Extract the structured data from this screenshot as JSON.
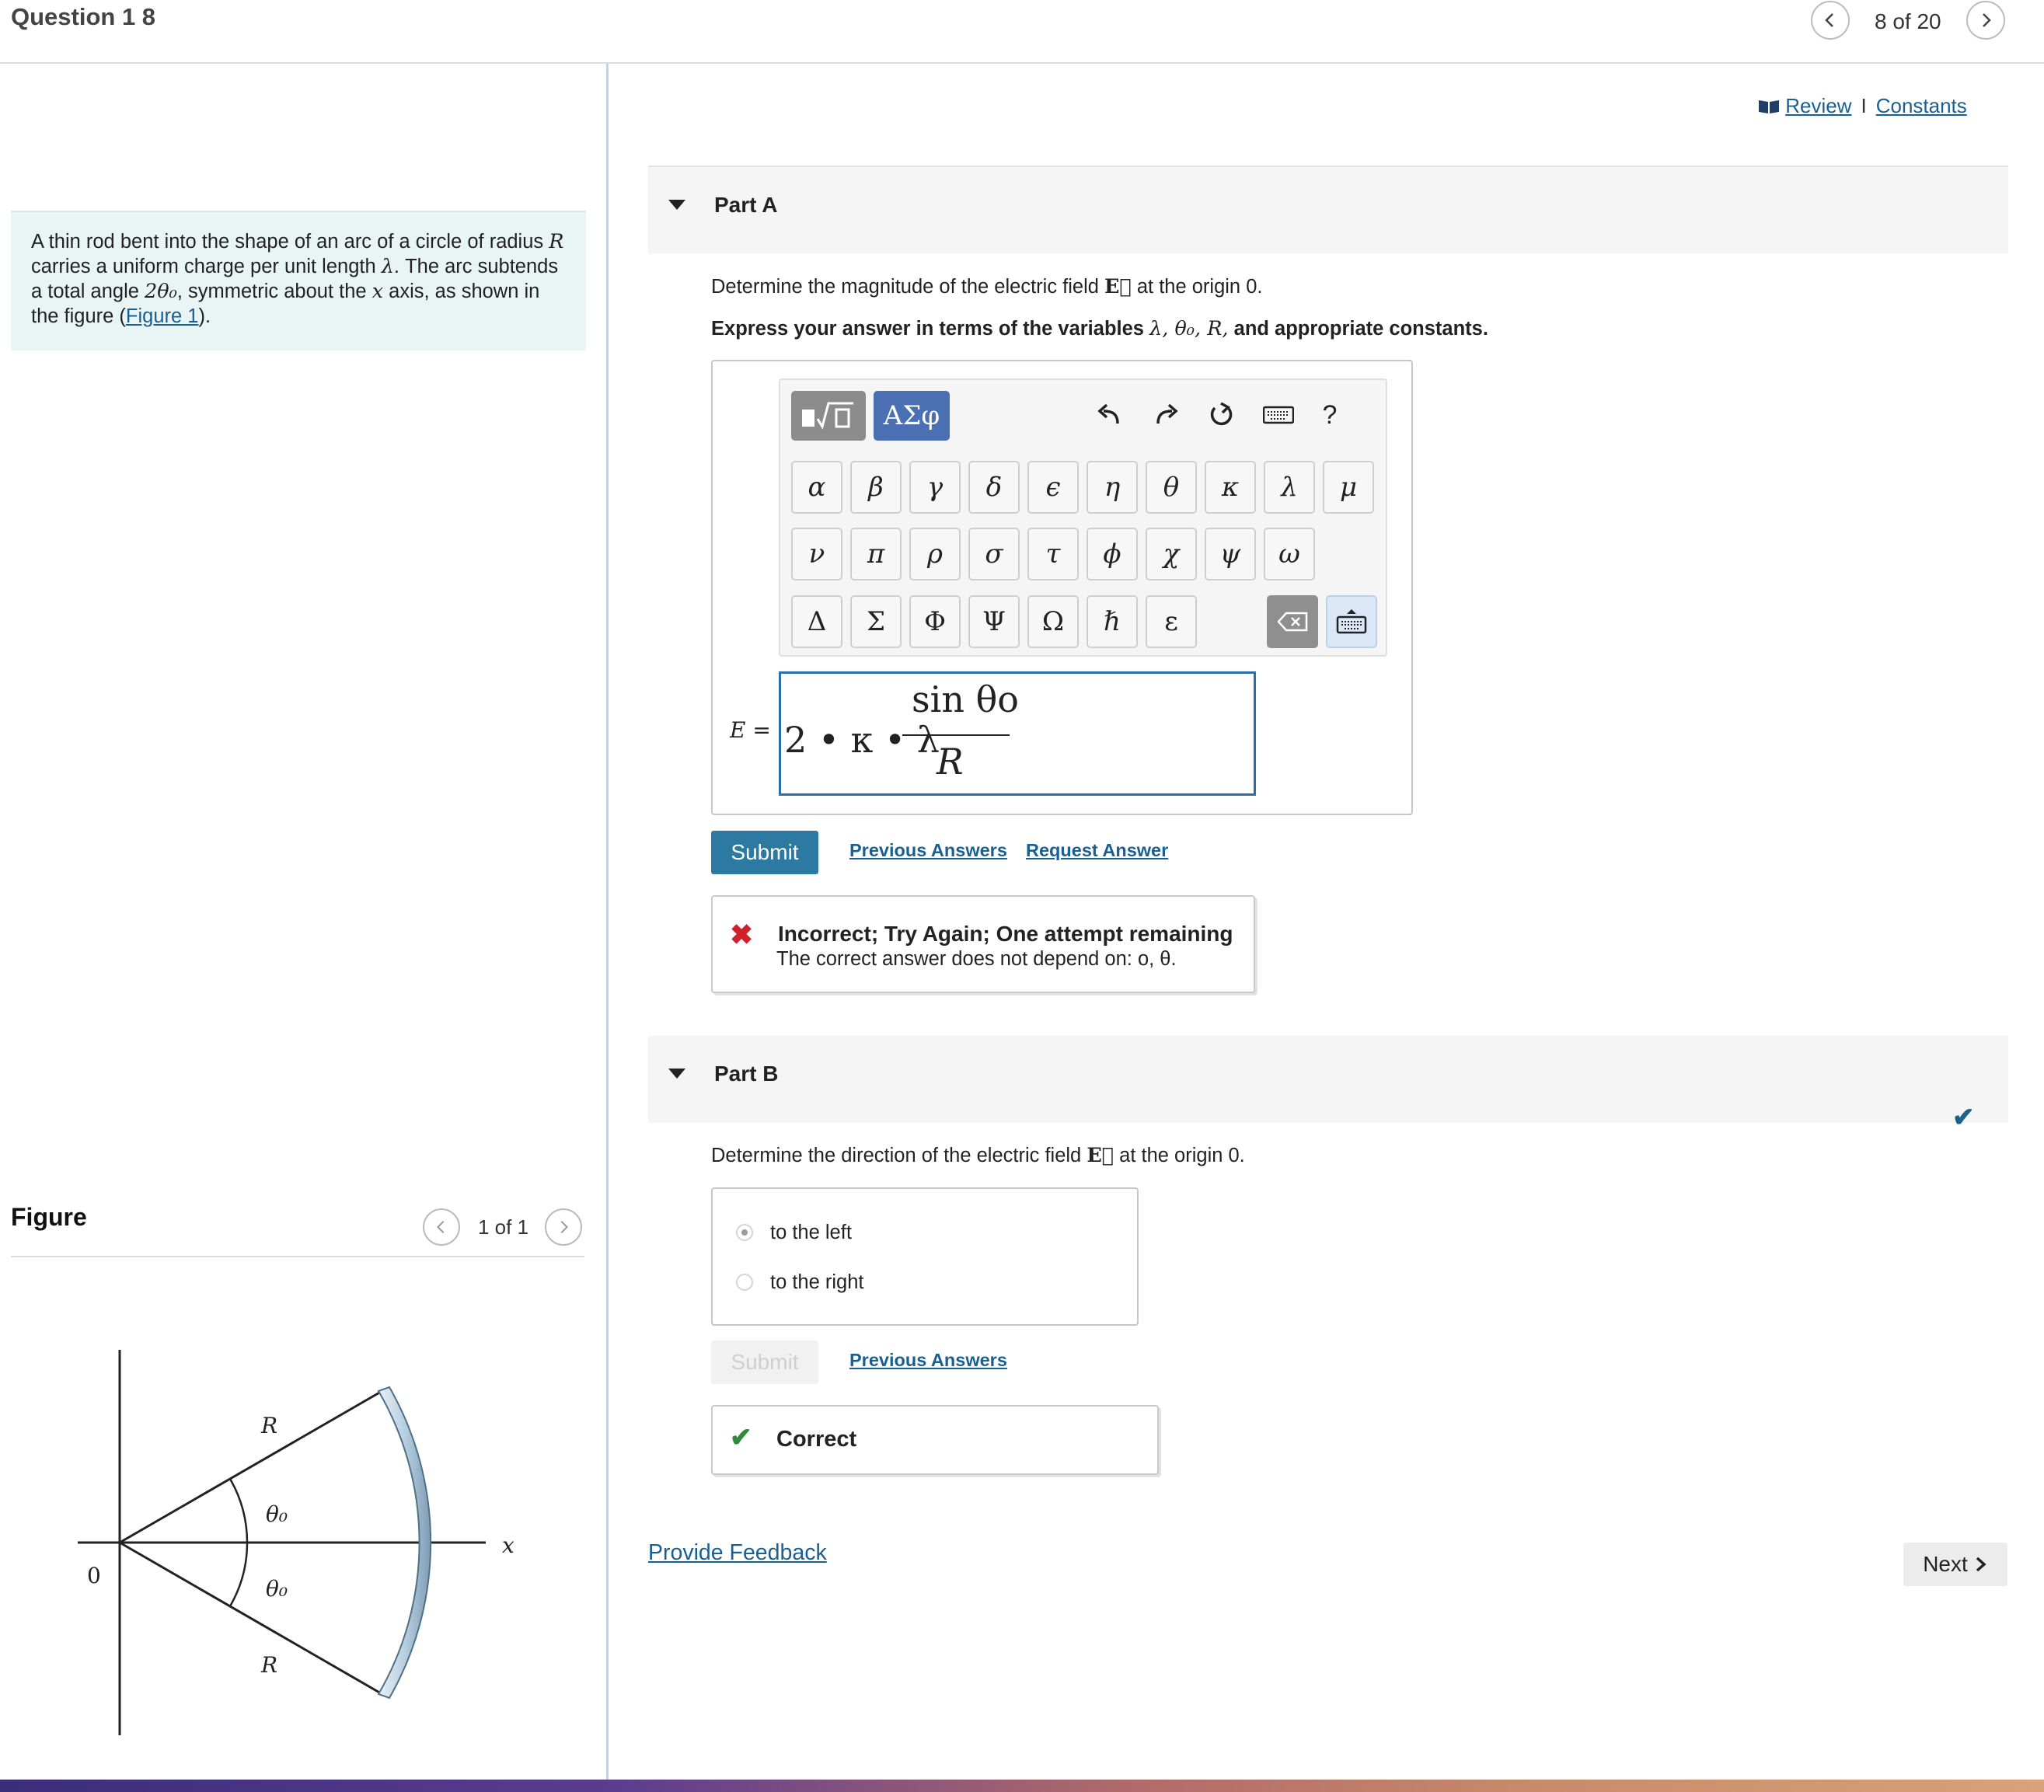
{
  "header": {
    "title": "Question 1 8",
    "counter": "8 of 20"
  },
  "intro": {
    "part1": "A thin rod bent into the shape of an arc of a circle of radius ",
    "var_R": "R",
    "part2": " carries a uniform charge per unit length ",
    "var_lambda": "λ",
    "part3": ". The arc subtends a total angle ",
    "angle": "2θ₀",
    "part4": ", symmetric about the ",
    "var_x": "x",
    "part5": " axis, as shown in the figure (",
    "figure_link": "Figure 1",
    "part6": ")."
  },
  "figure": {
    "title": "Figure",
    "counter": "1 of 1",
    "labels": {
      "origin": "0",
      "R_top": "R",
      "R_bottom": "R",
      "theta_top": "θ₀",
      "theta_bottom": "θ₀",
      "x_axis": "x"
    }
  },
  "links": {
    "review": "Review",
    "separator": "I",
    "constants": "Constants"
  },
  "partA": {
    "title": "Part A",
    "prompt_pre": "Determine the magnitude of the electric field ",
    "vector": "E⃗",
    "prompt_post": " at the origin 0.",
    "express_pre": "Express your answer in terms of the variables ",
    "express_vars": "λ, θ₀, R,",
    "express_post": " and appropriate constants.",
    "toolbar": {
      "greek_label": "ΑΣφ",
      "help_label": "?"
    },
    "keys_row1": [
      "α",
      "β",
      "γ",
      "δ",
      "ϵ",
      "η",
      "θ",
      "κ",
      "λ",
      "μ"
    ],
    "keys_row2": [
      "ν",
      "π",
      "ρ",
      "σ",
      "τ",
      "ϕ",
      "χ",
      "ψ",
      "ω"
    ],
    "keys_row3": [
      "Δ",
      "Σ",
      "Φ",
      "Ψ",
      "Ω",
      "ℏ",
      "ε"
    ],
    "answer_label": "E =",
    "answer_prefix": "2 • κ • λ",
    "answer_numerator": "sin θo",
    "answer_denominator": "R",
    "submit_label": "Submit",
    "previous_answers": "Previous Answers",
    "request_answer": "Request Answer",
    "feedback_title": "Incorrect; Try Again; One attempt remaining",
    "feedback_detail": "The correct answer does not depend on: o, θ."
  },
  "partB": {
    "title": "Part B",
    "prompt_pre": "Determine the direction of the electric field ",
    "vector": "E⃗",
    "prompt_post": " at the origin 0.",
    "options": [
      "to the left",
      "to the right"
    ],
    "selected": "to the left",
    "submit_label": "Submit",
    "previous_answers": "Previous Answers",
    "feedback_title": "Correct"
  },
  "footer": {
    "provide_feedback": "Provide Feedback",
    "next": "Next"
  },
  "colors": {
    "accent": "#2c7aa1",
    "link": "#1a5f91",
    "error": "#d0202a",
    "success": "#2f8a3a"
  }
}
